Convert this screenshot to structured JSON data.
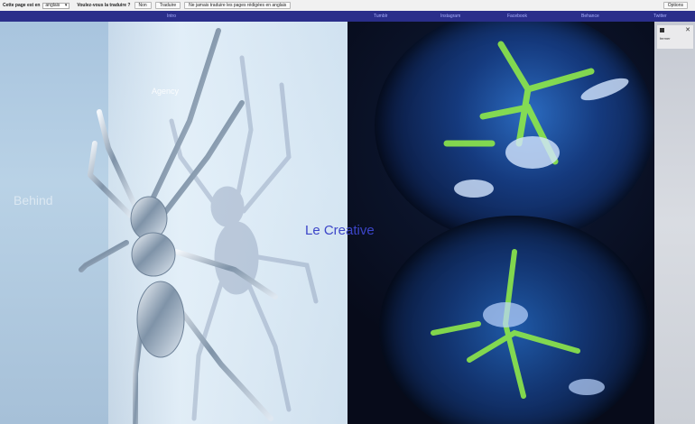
{
  "translate_bar": {
    "page_language_label": "Cette page est en",
    "language_value": "anglais",
    "question": "Voulez-vous la traduire ?",
    "no_button": "Non",
    "translate_button": "Traduire",
    "never_button": "Ne jamais traduire les pages rédigées en anglais",
    "options_button": "Options"
  },
  "nav": {
    "home": "Intro",
    "links": [
      "Tumblr",
      "Instagram",
      "Facebook",
      "Behance",
      "Twitter"
    ]
  },
  "hero": {
    "agency_label": "Agency",
    "faded_text": "Behind",
    "brand_title": "Le Creative"
  },
  "side_panel": {
    "caption": "fermer"
  },
  "colors": {
    "nav_bg": "#2a2e8a",
    "brand_text": "#3c45c8",
    "accent_green": "#8ee84a"
  },
  "icons": [
    "spider-image",
    "glass-orb-image",
    "close-icon",
    "dropdown-arrow-icon"
  ]
}
